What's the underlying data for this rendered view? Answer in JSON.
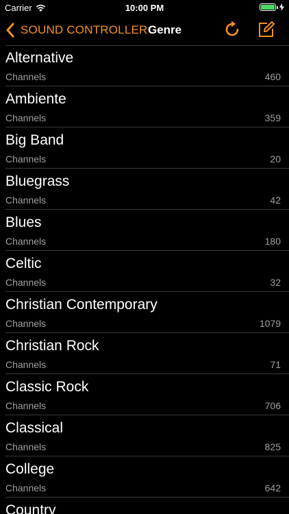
{
  "status_bar": {
    "carrier": "Carrier",
    "time": "10:00 PM",
    "battery_level": 1.0
  },
  "nav": {
    "back_label": "SOUND CONTROLLER",
    "title": "Genre",
    "accent_color": "#f5921e"
  },
  "list": {
    "items": [
      {
        "title": "Alternative",
        "subtitle": "Channels",
        "count": "460"
      },
      {
        "title": "Ambiente",
        "subtitle": "Channels",
        "count": "359"
      },
      {
        "title": "Big Band",
        "subtitle": "Channels",
        "count": "20"
      },
      {
        "title": "Bluegrass",
        "subtitle": "Channels",
        "count": "42"
      },
      {
        "title": "Blues",
        "subtitle": "Channels",
        "count": "180"
      },
      {
        "title": "Celtic",
        "subtitle": "Channels",
        "count": "32"
      },
      {
        "title": "Christian Contemporary",
        "subtitle": "Channels",
        "count": "1079"
      },
      {
        "title": "Christian Rock",
        "subtitle": "Channels",
        "count": "71"
      },
      {
        "title": "Classic Rock",
        "subtitle": "Channels",
        "count": "706"
      },
      {
        "title": "Classical",
        "subtitle": "Channels",
        "count": "825"
      },
      {
        "title": "College",
        "subtitle": "Channels",
        "count": "642"
      },
      {
        "title": "Country",
        "subtitle": "",
        "count": ""
      }
    ]
  }
}
